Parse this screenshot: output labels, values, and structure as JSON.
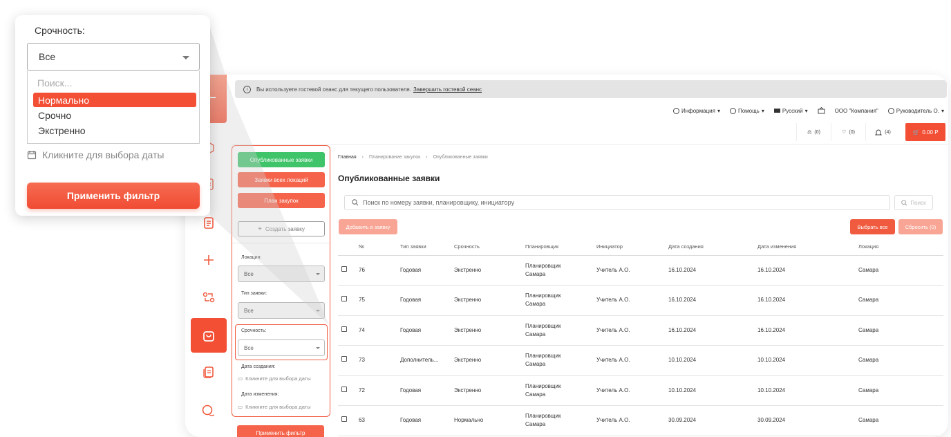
{
  "banner": {
    "text": "Вы используете гостевой сеанс для текущего пользователя.",
    "link": "Завершить гостевой сеанс"
  },
  "topnav": {
    "info": "Информация",
    "help": "Помощь",
    "language": "Русский",
    "company": "ООО \"Компания\"",
    "user": "Руководитель О."
  },
  "widgets": {
    "compare_count": "(0)",
    "favorites_count": "(0)",
    "notifications_count": "(4)",
    "cart_total": "0.00 Р"
  },
  "filter": {
    "published_button": "Опубликованные заявки",
    "all_locations_button": "Заявки всех локаций",
    "purchase_plan_button": "План закупок",
    "create_button": "Создать заявку",
    "location_label": "Локация:",
    "location_value": "Все",
    "type_label": "Тип заявки:",
    "type_value": "Все",
    "urgency_label": "Срочность:",
    "urgency_value": "Все",
    "created_label": "Дата создания:",
    "created_placeholder": "Кликните для выбора даты",
    "modified_label": "Дата изменения:",
    "modified_placeholder": "Кликните для выбора даты",
    "apply_button": "Применить фильтр"
  },
  "breadcrumb": {
    "home": "Главная",
    "level1": "Планирование закупок",
    "level2": "Опубликованные заявки",
    "separator": "›"
  },
  "page": {
    "title": "Опубликованные заявки",
    "search_placeholder": "Поиск по номеру заявки, планировщику, инициатору",
    "search_button": "Поиск",
    "add_to_request": "Добавить в заявку",
    "select_all": "Выбрать все",
    "reset": "Сбросить (0)"
  },
  "table": {
    "headers": [
      "№",
      "Тип заявки",
      "Срочность",
      "Планировщик",
      "Инициатор",
      "Дата создания",
      "Дата изменения",
      "Локация"
    ],
    "rows": [
      {
        "num": "76",
        "type": "Годовая",
        "urgency": "Экстренно",
        "planner1": "Планировщик",
        "planner2": "Самара",
        "initiator": "Учитель А.О.",
        "created": "16.10.2024",
        "modified": "16.10.2024",
        "location": "Самара"
      },
      {
        "num": "75",
        "type": "Годовая",
        "urgency": "Экстренно",
        "planner1": "Планировщик",
        "planner2": "Самара",
        "initiator": "Учитель А.О.",
        "created": "16.10.2024",
        "modified": "16.10.2024",
        "location": "Самара"
      },
      {
        "num": "74",
        "type": "Годовая",
        "urgency": "Экстренно",
        "planner1": "Планировщик",
        "planner2": "Самара",
        "initiator": "Учитель А.О.",
        "created": "16.10.2024",
        "modified": "16.10.2024",
        "location": "Самара"
      },
      {
        "num": "73",
        "type": "Дополнитель...",
        "urgency": "Экстренно",
        "planner1": "Планировщик",
        "planner2": "Самара",
        "initiator": "Учитель А.О.",
        "created": "10.10.2024",
        "modified": "10.10.2024",
        "location": "Самара"
      },
      {
        "num": "72",
        "type": "Годовая",
        "urgency": "Экстренно",
        "planner1": "Планировщик",
        "planner2": "Самара",
        "initiator": "Учитель А.О.",
        "created": "10.10.2024",
        "modified": "10.10.2024",
        "location": "Самара"
      },
      {
        "num": "63",
        "type": "Годовая",
        "urgency": "Нормально",
        "planner1": "Планировщик",
        "planner2": "Самара",
        "initiator": "Учитель А.О.",
        "created": "30.09.2024",
        "modified": "30.09.2024",
        "location": "Самара"
      }
    ]
  },
  "zoom": {
    "label": "Срочность:",
    "value": "Все",
    "search_placeholder": "Поиск...",
    "options": [
      "Нормально",
      "Срочно",
      "Экстренно"
    ],
    "selected_option": "Нормально",
    "date_placeholder": "Кликните для выбора даты",
    "apply_button": "Применить фильтр"
  },
  "colors": {
    "accent": "#f24f35",
    "accent_light": "#f8a595",
    "green": "#3fc46a"
  }
}
